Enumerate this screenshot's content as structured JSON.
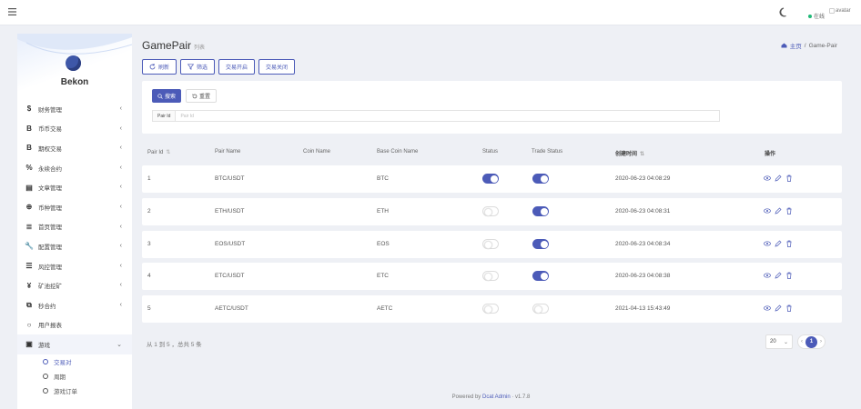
{
  "topbar": {
    "menu_icon": "hamburger-icon",
    "theme_icon": "moon-icon",
    "online_label": "在线",
    "avatar_alt": "avatar"
  },
  "sidebar": {
    "brand": "Bekon",
    "items": [
      {
        "icon": "$",
        "label": "财务管理",
        "chevron": "‹"
      },
      {
        "icon": "B",
        "label": "币币交易",
        "chevron": "‹"
      },
      {
        "icon": "B",
        "label": "期权交易",
        "chevron": "‹"
      },
      {
        "icon": "%",
        "label": "永续合约",
        "chevron": "‹"
      },
      {
        "icon": "▤",
        "label": "文章管理",
        "chevron": "‹"
      },
      {
        "icon": "⊕",
        "label": "币种管理",
        "chevron": "‹"
      },
      {
        "icon": "≣",
        "label": "首页管理",
        "chevron": "‹"
      },
      {
        "icon": "🔧",
        "label": "配置管理",
        "chevron": "‹"
      },
      {
        "icon": "☰",
        "label": "风控管理",
        "chevron": "‹"
      },
      {
        "icon": "¥",
        "label": "矿池挖矿",
        "chevron": "‹"
      },
      {
        "icon": "⧉",
        "label": "秒合约",
        "chevron": "‹"
      },
      {
        "icon": "○",
        "label": "用户报表",
        "chevron": ""
      },
      {
        "icon": "▣",
        "label": "游戏",
        "chevron": "⌄"
      }
    ],
    "submenu": [
      {
        "label": "交易对",
        "selected": true
      },
      {
        "label": "周期",
        "selected": false
      },
      {
        "label": "游戏订单",
        "selected": false
      }
    ]
  },
  "header": {
    "title": "GamePair",
    "subtitle": "列表",
    "breadcrumb_home": "主页",
    "breadcrumb_sep": "/",
    "breadcrumb_current": "Game-Pair"
  },
  "toolbar": {
    "refresh": "刷新",
    "filter": "筛选",
    "open_trade": "交易开启",
    "close_trade": "交易关闭"
  },
  "filter": {
    "search_label": "搜索",
    "reset_label": "重置",
    "pair_id_label": "Pair Id",
    "pair_id_placeholder": "Pair Id"
  },
  "table": {
    "columns": {
      "pair_id": "Pair Id",
      "pair_name": "Pair Name",
      "coin_name": "Coin Name",
      "base_coin_name": "Base Coin Name",
      "status": "Status",
      "trade_status": "Trade Status",
      "created_at": "创建时间",
      "actions": "操作"
    },
    "rows": [
      {
        "id": "1",
        "pair_name": "BTC/USDT",
        "coin_name": "",
        "base": "BTC",
        "status": true,
        "trade_status": true,
        "created": "2020-06-23 04:08:29"
      },
      {
        "id": "2",
        "pair_name": "ETH/USDT",
        "coin_name": "",
        "base": "ETH",
        "status": false,
        "trade_status": true,
        "created": "2020-06-23 04:08:31"
      },
      {
        "id": "3",
        "pair_name": "EOS/USDT",
        "coin_name": "",
        "base": "EOS",
        "status": false,
        "trade_status": true,
        "created": "2020-06-23 04:08:34"
      },
      {
        "id": "4",
        "pair_name": "ETC/USDT",
        "coin_name": "",
        "base": "ETC",
        "status": false,
        "trade_status": true,
        "created": "2020-06-23 04:08:38"
      },
      {
        "id": "5",
        "pair_name": "AETC/USDT",
        "coin_name": "",
        "base": "AETC",
        "status": false,
        "trade_status": false,
        "created": "2021-04-13 15:43:49"
      }
    ]
  },
  "pagination": {
    "summary": "从 1 到 5 ，总共 5 条",
    "per_page": "20",
    "current_page": "1",
    "prev": "‹",
    "next": "›"
  },
  "footer": {
    "prefix": "Powered by",
    "link": "Dcat Admin",
    "sep": "·",
    "version": "v1.7.8"
  },
  "colors": {
    "accent": "#4c5bb8",
    "online": "#21b978",
    "background": "#eef0f5"
  }
}
